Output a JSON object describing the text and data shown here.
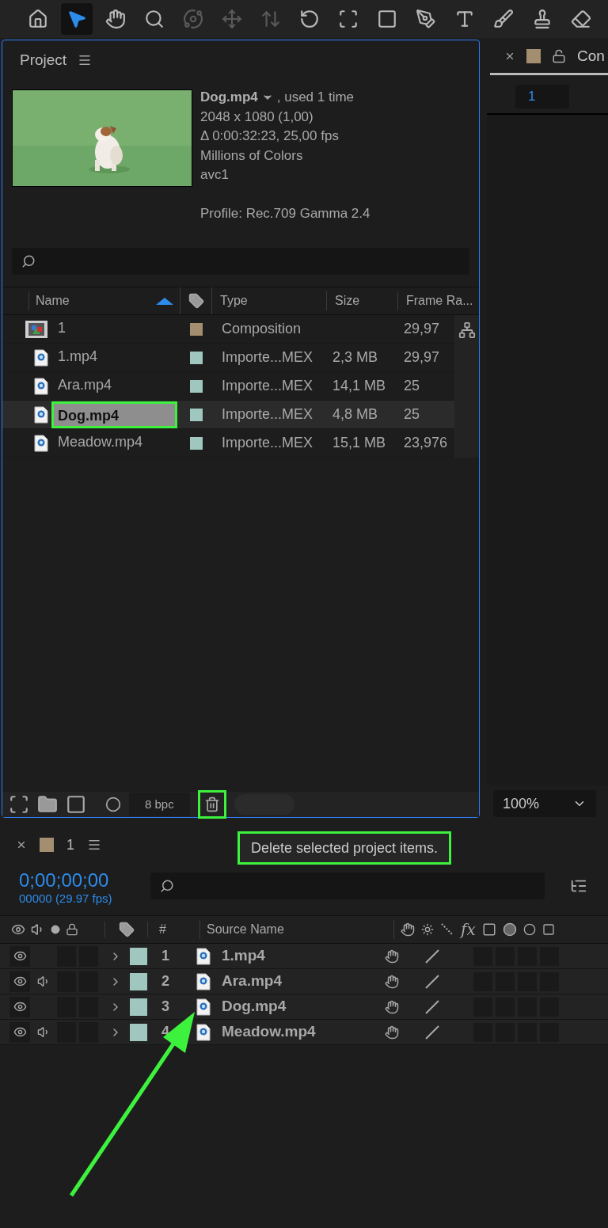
{
  "toolbar": {
    "tools": [
      {
        "kind": "home",
        "selected": false
      },
      {
        "kind": "select",
        "selected": true
      },
      {
        "kind": "hand",
        "selected": false
      },
      {
        "kind": "zoom",
        "selected": false
      },
      {
        "kind": "orbit",
        "selected": false
      },
      {
        "kind": "move",
        "selected": false
      },
      {
        "kind": "dolly",
        "selected": false
      },
      {
        "kind": "rotate",
        "selected": false
      },
      {
        "kind": "anchor",
        "selected": false
      },
      {
        "kind": "rect",
        "selected": false
      },
      {
        "kind": "pen",
        "selected": false
      },
      {
        "kind": "type",
        "selected": false
      },
      {
        "kind": "brush",
        "selected": false
      },
      {
        "kind": "stamp",
        "selected": false
      },
      {
        "kind": "eraser",
        "selected": false
      }
    ]
  },
  "project": {
    "title": "Project",
    "preview": {
      "name": "Dog.mp4",
      "usage": ", used 1 time",
      "details": [
        "2048 x 1080 (1,00)",
        "Δ 0:00:32:23, 25,00 fps",
        "Millions of Colors",
        "avc1"
      ],
      "profile": "Profile: Rec.709 Gamma 2.4"
    },
    "columns": {
      "name": "Name",
      "type": "Type",
      "size": "Size",
      "frame_rate": "Frame Ra..."
    },
    "items": [
      {
        "kind": "composition",
        "name": "1",
        "color": "#a38f6f",
        "type": "Composition",
        "frame_rate": "29,97",
        "selected": false
      },
      {
        "kind": "footage",
        "name": "1.mp4",
        "color": "#9fc6bf",
        "type": "Importe...MEX",
        "size": "2,3 MB",
        "frame_rate": "29,97",
        "selected": false
      },
      {
        "kind": "footage",
        "name": "Ara.mp4",
        "color": "#9fc6bf",
        "type": "Importe...MEX",
        "size": "14,1 MB",
        "frame_rate": "25",
        "selected": false
      },
      {
        "kind": "footage",
        "name": "Dog.mp4",
        "color": "#9fc6bf",
        "type": "Importe...MEX",
        "size": "4,8 MB",
        "frame_rate": "25",
        "selected": true
      },
      {
        "kind": "footage",
        "name": "Meadow.mp4",
        "color": "#9fc6bf",
        "type": "Importe...MEX",
        "size": "15,1 MB",
        "frame_rate": "23,976",
        "selected": false
      }
    ],
    "footer": {
      "bit_depth": "8 bpc",
      "trash_highlighted": true
    },
    "tooltip": "Delete selected project items."
  },
  "composition_panel": {
    "tab": "Con",
    "field": "1",
    "zoom": "100%"
  },
  "timeline": {
    "tab": "1",
    "timecode": "0;00;00;00",
    "frame_info": "00000 (29.97 fps)",
    "columns": {
      "number": "#",
      "source_name": "Source Name",
      "fx": "fx"
    },
    "layers": [
      {
        "number": "1",
        "name": "1.mp4",
        "audio": false,
        "color": "#9fc6bf"
      },
      {
        "number": "2",
        "name": "Ara.mp4",
        "audio": true,
        "color": "#9fc6bf"
      },
      {
        "number": "3",
        "name": "Dog.mp4",
        "audio": false,
        "color": "#9fc6bf"
      },
      {
        "number": "4",
        "name": "Meadow.mp4",
        "audio": true,
        "color": "#9fc6bf"
      }
    ]
  }
}
